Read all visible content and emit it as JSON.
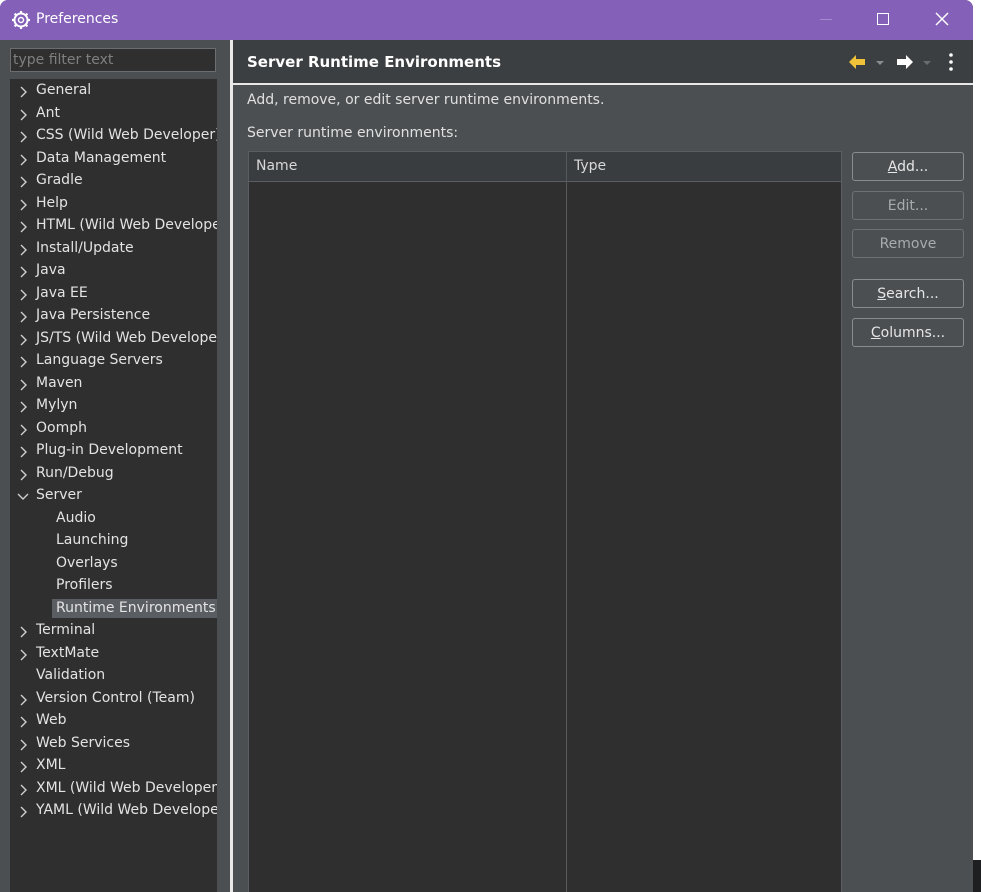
{
  "window": {
    "title": "Preferences",
    "colors": {
      "titlebar": "#8560b9",
      "background": "#4b4f52",
      "tree_bg": "#2f2f2f"
    }
  },
  "filter": {
    "placeholder": "type filter text",
    "value": ""
  },
  "tree": {
    "items": [
      {
        "label": "General",
        "expanded": false
      },
      {
        "label": "Ant",
        "expanded": false
      },
      {
        "label": "CSS (Wild Web Developer)",
        "expanded": false
      },
      {
        "label": "Data Management",
        "expanded": false
      },
      {
        "label": "Gradle",
        "expanded": false
      },
      {
        "label": "Help",
        "expanded": false
      },
      {
        "label": "HTML (Wild Web Develope",
        "expanded": false
      },
      {
        "label": "Install/Update",
        "expanded": false
      },
      {
        "label": "Java",
        "expanded": false
      },
      {
        "label": "Java EE",
        "expanded": false
      },
      {
        "label": "Java Persistence",
        "expanded": false
      },
      {
        "label": "JS/TS (Wild Web Developer",
        "expanded": false
      },
      {
        "label": "Language Servers",
        "expanded": false
      },
      {
        "label": "Maven",
        "expanded": false
      },
      {
        "label": "Mylyn",
        "expanded": false
      },
      {
        "label": "Oomph",
        "expanded": false
      },
      {
        "label": "Plug-in Development",
        "expanded": false
      },
      {
        "label": "Run/Debug",
        "expanded": false
      },
      {
        "label": "Server",
        "expanded": true
      },
      {
        "label": "Audio",
        "child": true
      },
      {
        "label": "Launching",
        "child": true
      },
      {
        "label": "Overlays",
        "child": true
      },
      {
        "label": "Profilers",
        "child": true
      },
      {
        "label": "Runtime Environments",
        "child": true,
        "selected": true
      },
      {
        "label": "Terminal",
        "expanded": false
      },
      {
        "label": "TextMate",
        "expanded": false
      },
      {
        "label": "Validation",
        "noChevron": true
      },
      {
        "label": "Version Control (Team)",
        "expanded": false
      },
      {
        "label": "Web",
        "expanded": false
      },
      {
        "label": "Web Services",
        "expanded": false
      },
      {
        "label": "XML",
        "expanded": false
      },
      {
        "label": "XML (Wild Web Developer)",
        "expanded": false
      },
      {
        "label": "YAML (Wild Web Develope",
        "expanded": false
      }
    ]
  },
  "page": {
    "title": "Server Runtime Environments",
    "description": "Add, remove, or edit server runtime environments.",
    "list_label": "Server runtime environments:",
    "columns": [
      "Name",
      "Type"
    ],
    "rows": []
  },
  "buttons": {
    "add": "Add...",
    "edit": "Edit...",
    "remove": "Remove",
    "search": "Search...",
    "columns": "Columns..."
  },
  "icons": {
    "window": "gear-icon",
    "back": "back-arrow-icon",
    "forward": "forward-arrow-icon",
    "menu": "vertical-dots-icon"
  }
}
